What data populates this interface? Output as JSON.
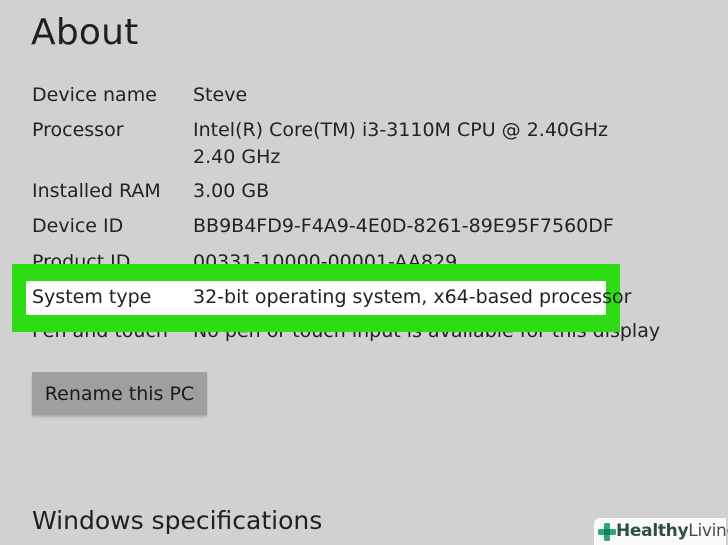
{
  "page": {
    "title": "About"
  },
  "specs": [
    {
      "label": "Device name",
      "value": "Steve"
    },
    {
      "label": "Processor",
      "value": "Intel(R) Core(TM) i3-3110M CPU @ 2.40GHz   2.40 GHz"
    },
    {
      "label": "Installed RAM",
      "value": "3.00 GB"
    },
    {
      "label": "Device ID",
      "value": "BB9B4FD9-F4A9-4E0D-8261-89E95F7560DF"
    },
    {
      "label": "Product ID",
      "value": "00331-10000-00001-AA829"
    },
    {
      "label": "System type",
      "value": "32-bit operating system, x64-based processor"
    },
    {
      "label": "Pen and touch",
      "value": "No pen or touch input is available for this display"
    }
  ],
  "actions": {
    "rename_label": "Rename this PC"
  },
  "sections": {
    "windows_specs_title": "Windows specifications"
  },
  "watermark": {
    "brand": "Healthy",
    "brand2": "Living"
  },
  "colors": {
    "highlight": "#2ddc13",
    "background": "#d1d1d1",
    "button": "#9f9f9f"
  }
}
